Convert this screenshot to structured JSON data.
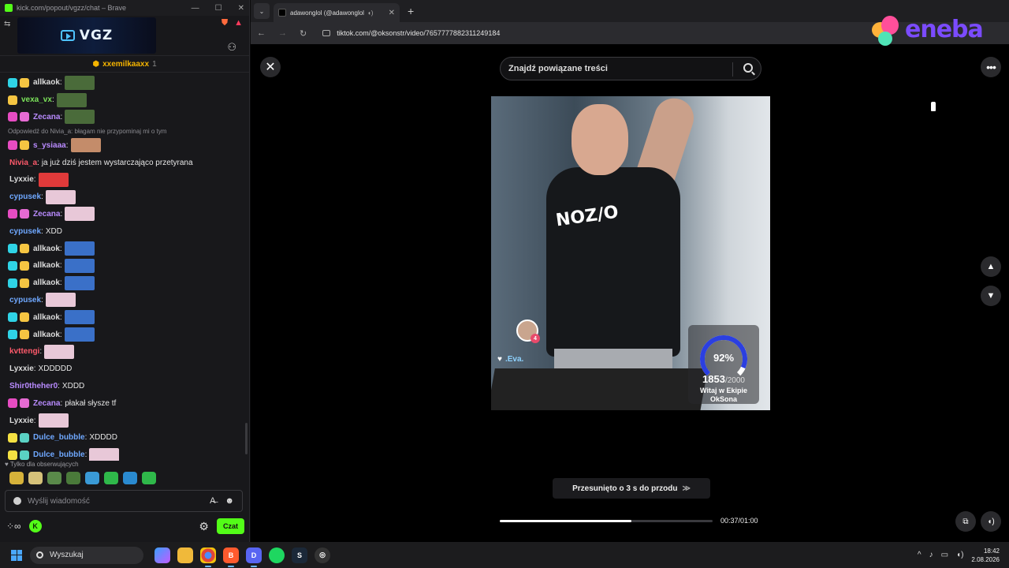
{
  "chat_window": {
    "title": "kick.com/popout/vgzz/chat – Brave",
    "banner_text": "VGZ",
    "pinned": {
      "user": "xxemilkaaxx",
      "count": "1"
    },
    "messages": [
      {
        "user": "allkaok",
        "sep": ":",
        "text": "",
        "color": "#dcdcdc",
        "emote": "#4a6b3a",
        "badges": [
          "#2fd3e6",
          "#f5c542"
        ]
      },
      {
        "user": "vexa_vx",
        "sep": ":",
        "text": "",
        "color": "#7be35a",
        "emote": "#4a6b3a",
        "badges": [
          "#f5c542"
        ]
      },
      {
        "user": "Zecana",
        "sep": ":",
        "text": "",
        "color": "#b98bff",
        "emote": "#4a6b3a",
        "badges": [
          "#e64cc2",
          "#e66bd3"
        ]
      },
      {
        "reply": "Odpowiedź do Nivia_a: błagam nie przypominaj mi o tym"
      },
      {
        "user": "s_ysiaaa",
        "sep": ":",
        "text": "",
        "color": "#b98bff",
        "emote": "#c48c6a",
        "badges": [
          "#e64cc2",
          "#f5c542"
        ]
      },
      {
        "user": "Nivia_a",
        "sep": ":",
        "text": "ja już dziś jestem wystarczająco przetyrana",
        "color": "#ff5a6b",
        "emote": "",
        "badges": []
      },
      {
        "user": "Lyxxie",
        "sep": ":",
        "text": "",
        "color": "#dcdcdc",
        "emote": "#e03a3a",
        "badges": []
      },
      {
        "user": "cypusek",
        "sep": ":",
        "text": "",
        "color": "#6fa8ff",
        "emote": "#e8c8d8",
        "badges": []
      },
      {
        "user": "Zecana",
        "sep": ":",
        "text": "",
        "color": "#b98bff",
        "emote": "#e8c8d8",
        "badges": [
          "#e64cc2",
          "#e66bd3"
        ]
      },
      {
        "user": "cypusek",
        "sep": ":",
        "text": "XDD",
        "color": "#6fa8ff",
        "emote": "",
        "badges": []
      },
      {
        "user": "allkaok",
        "sep": ":",
        "text": "",
        "color": "#dcdcdc",
        "emote": "#3a70c8",
        "badges": [
          "#2fd3e6",
          "#f5c542"
        ]
      },
      {
        "user": "allkaok",
        "sep": ":",
        "text": "",
        "color": "#dcdcdc",
        "emote": "#3a70c8",
        "badges": [
          "#2fd3e6",
          "#f5c542"
        ]
      },
      {
        "user": "allkaok",
        "sep": ":",
        "text": "",
        "color": "#dcdcdc",
        "emote": "#3a70c8",
        "badges": [
          "#2fd3e6",
          "#f5c542"
        ]
      },
      {
        "user": "cypusek",
        "sep": ":",
        "text": "",
        "color": "#6fa8ff",
        "emote": "#e8c8d8",
        "badges": []
      },
      {
        "user": "allkaok",
        "sep": ":",
        "text": "",
        "color": "#dcdcdc",
        "emote": "#3a70c8",
        "badges": [
          "#2fd3e6",
          "#f5c542"
        ]
      },
      {
        "user": "allkaok",
        "sep": ":",
        "text": "",
        "color": "#dcdcdc",
        "emote": "#3a70c8",
        "badges": [
          "#2fd3e6",
          "#f5c542"
        ]
      },
      {
        "user": "kvttengi",
        "sep": ":",
        "text": "",
        "color": "#ff5a6b",
        "emote": "#e8c8d8",
        "badges": []
      },
      {
        "user": "Lyxxie",
        "sep": ":",
        "text": "XDDDDD",
        "color": "#dcdcdc",
        "emote": "",
        "badges": []
      },
      {
        "user": "Shir0theher0",
        "sep": ":",
        "text": "XDDD",
        "color": "#b98bff",
        "emote": "",
        "badges": []
      },
      {
        "user": "Zecana",
        "sep": ":",
        "text": "płakał słysze tf",
        "color": "#b98bff",
        "emote": "",
        "badges": [
          "#e64cc2",
          "#e66bd3"
        ]
      },
      {
        "user": "Lyxxie",
        "sep": ":",
        "text": "",
        "color": "#dcdcdc",
        "emote": "#e8c8d8",
        "badges": []
      },
      {
        "user": "Dulce_bubble",
        "sep": ":",
        "text": "XDDDD",
        "color": "#6fa8ff",
        "emote": "",
        "badges": [
          "#f5e142",
          "#5ad1c3"
        ]
      },
      {
        "user": "Dulce_bubble",
        "sep": ":",
        "text": "",
        "color": "#6fa8ff",
        "emote": "#e8c8d8",
        "badges": [
          "#f5e142",
          "#5ad1c3"
        ]
      }
    ],
    "followers_only": "Tylko dla obserwujących",
    "input_placeholder": "Wyślij wiadomość",
    "send_label": "Czat"
  },
  "browser": {
    "tab_title": "adawonglol (@adawonglol",
    "url": "tiktok.com/@oksonstr/video/7657777882311249184",
    "search_text": "Znajdź powiązane treści",
    "overlay_user": ".Eva.",
    "overlay_badge": "4",
    "video_print": "NOZ/O",
    "gauge": {
      "percent": 0.92,
      "percent_label": "92%",
      "count": "1853",
      "total": "/2000",
      "caption_line1": "Witaj w Ekipie",
      "caption_line2": "OkSona"
    },
    "skip_label": "Przesunięto o 3 s do przodu",
    "progress": 0.62,
    "time_label": "00:37/01:00",
    "ad_brand": "eneba"
  },
  "taskbar": {
    "search_label": "Wyszukaj",
    "time": "18:42",
    "date": "2.08.2026",
    "colors": {
      "accent": "#4aa8ff",
      "kick_green": "#53fc18"
    }
  }
}
